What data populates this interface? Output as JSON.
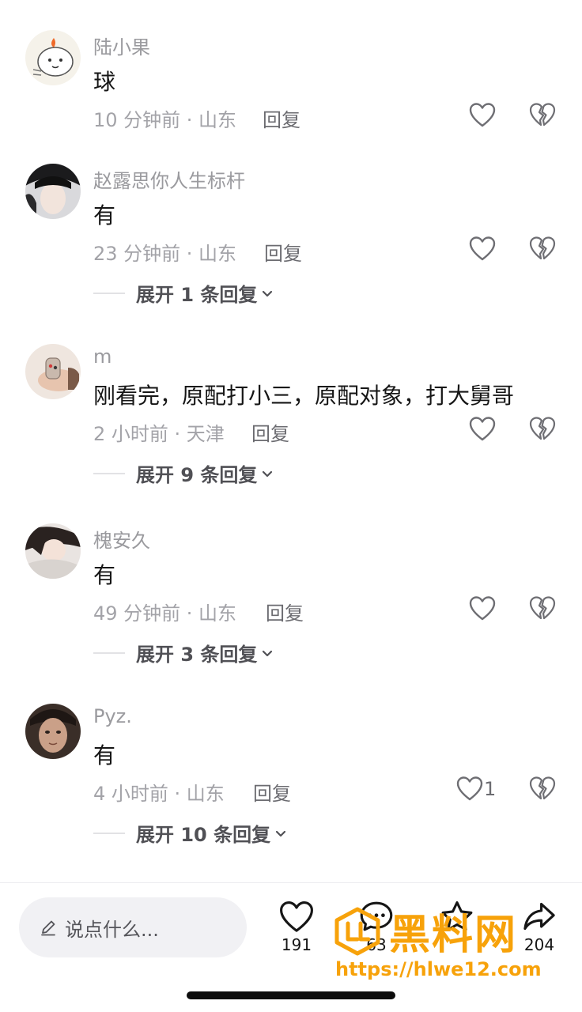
{
  "comments": [
    {
      "username": "陆小果",
      "text": "球",
      "meta": "10 分钟前 · 山东",
      "reply": "回复",
      "like_count": "",
      "expand": ""
    },
    {
      "username": "赵露思你人生标杆",
      "text": "有",
      "meta": "23 分钟前 · 山东",
      "reply": "回复",
      "like_count": "",
      "expand": "展开 1 条回复"
    },
    {
      "username": "m",
      "text": "刚看完，原配打小三，原配对象，打大舅哥",
      "meta": "2 小时前 · 天津",
      "reply": "回复",
      "like_count": "",
      "expand": "展开 9 条回复"
    },
    {
      "username": "槐安久",
      "text": "有",
      "meta": "49 分钟前 · 山东",
      "reply": "回复",
      "like_count": "",
      "expand": "展开 3 条回复"
    },
    {
      "username": "Pyz.",
      "text": "有",
      "meta": "4 小时前 · 山东",
      "reply": "回复",
      "like_count": "1",
      "expand": "展开 10 条回复"
    }
  ],
  "bottom_bar": {
    "input_placeholder": "说点什么...",
    "like_count": "191",
    "comment_count": "63",
    "share_count": "204"
  },
  "watermark": {
    "title": "黑料网",
    "url": "https://hlwe12.com"
  },
  "icons": {
    "like": "heart-outline-icon",
    "dislike": "broken-heart-icon",
    "expand": "chevron-down-icon",
    "edit": "pencil-icon",
    "comment": "chat-bubble-icon",
    "favorite": "star-icon",
    "share": "share-arrow-icon"
  },
  "colors": {
    "text_primary": "#161616",
    "text_secondary": "#9a9a9e",
    "watermark": "#f7a20a"
  }
}
